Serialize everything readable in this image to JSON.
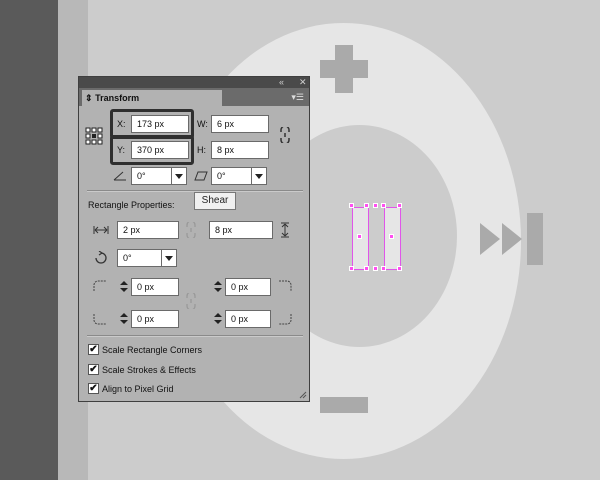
{
  "panel": {
    "collapse_icon": "double-chevron-icon",
    "close_glyph": "✕",
    "collapse_glyph": "«",
    "tab_label": "Transform",
    "tab_prefix": "⇕",
    "menu_glyph": "▾☰",
    "x_label": "X:",
    "x_value": "173 px",
    "y_label": "Y:",
    "y_value": "370 px",
    "w_label": "W:",
    "w_value": "6 px",
    "h_label": "H:",
    "h_value": "8 px",
    "rotate_value": "0°",
    "shear_value": "0°",
    "rect_props_label": "Rectangle Properties:",
    "rect_width": "2 px",
    "rect_height": "8 px",
    "rect_rotate": "0°",
    "corner_tl": "0 px",
    "corner_tr": "0 px",
    "corner_bl": "0 px",
    "corner_br": "0 px",
    "check_scale_corners": "Scale Rectangle Corners",
    "check_scale_strokes": "Scale Strokes & Effects",
    "check_align_pixel": "Align to Pixel Grid",
    "checked_glyph": "✔"
  },
  "tooltip": {
    "text": "Shear"
  },
  "colors": {
    "selection": "#ff4ef0",
    "panel_bg": "#b2b2b2"
  }
}
